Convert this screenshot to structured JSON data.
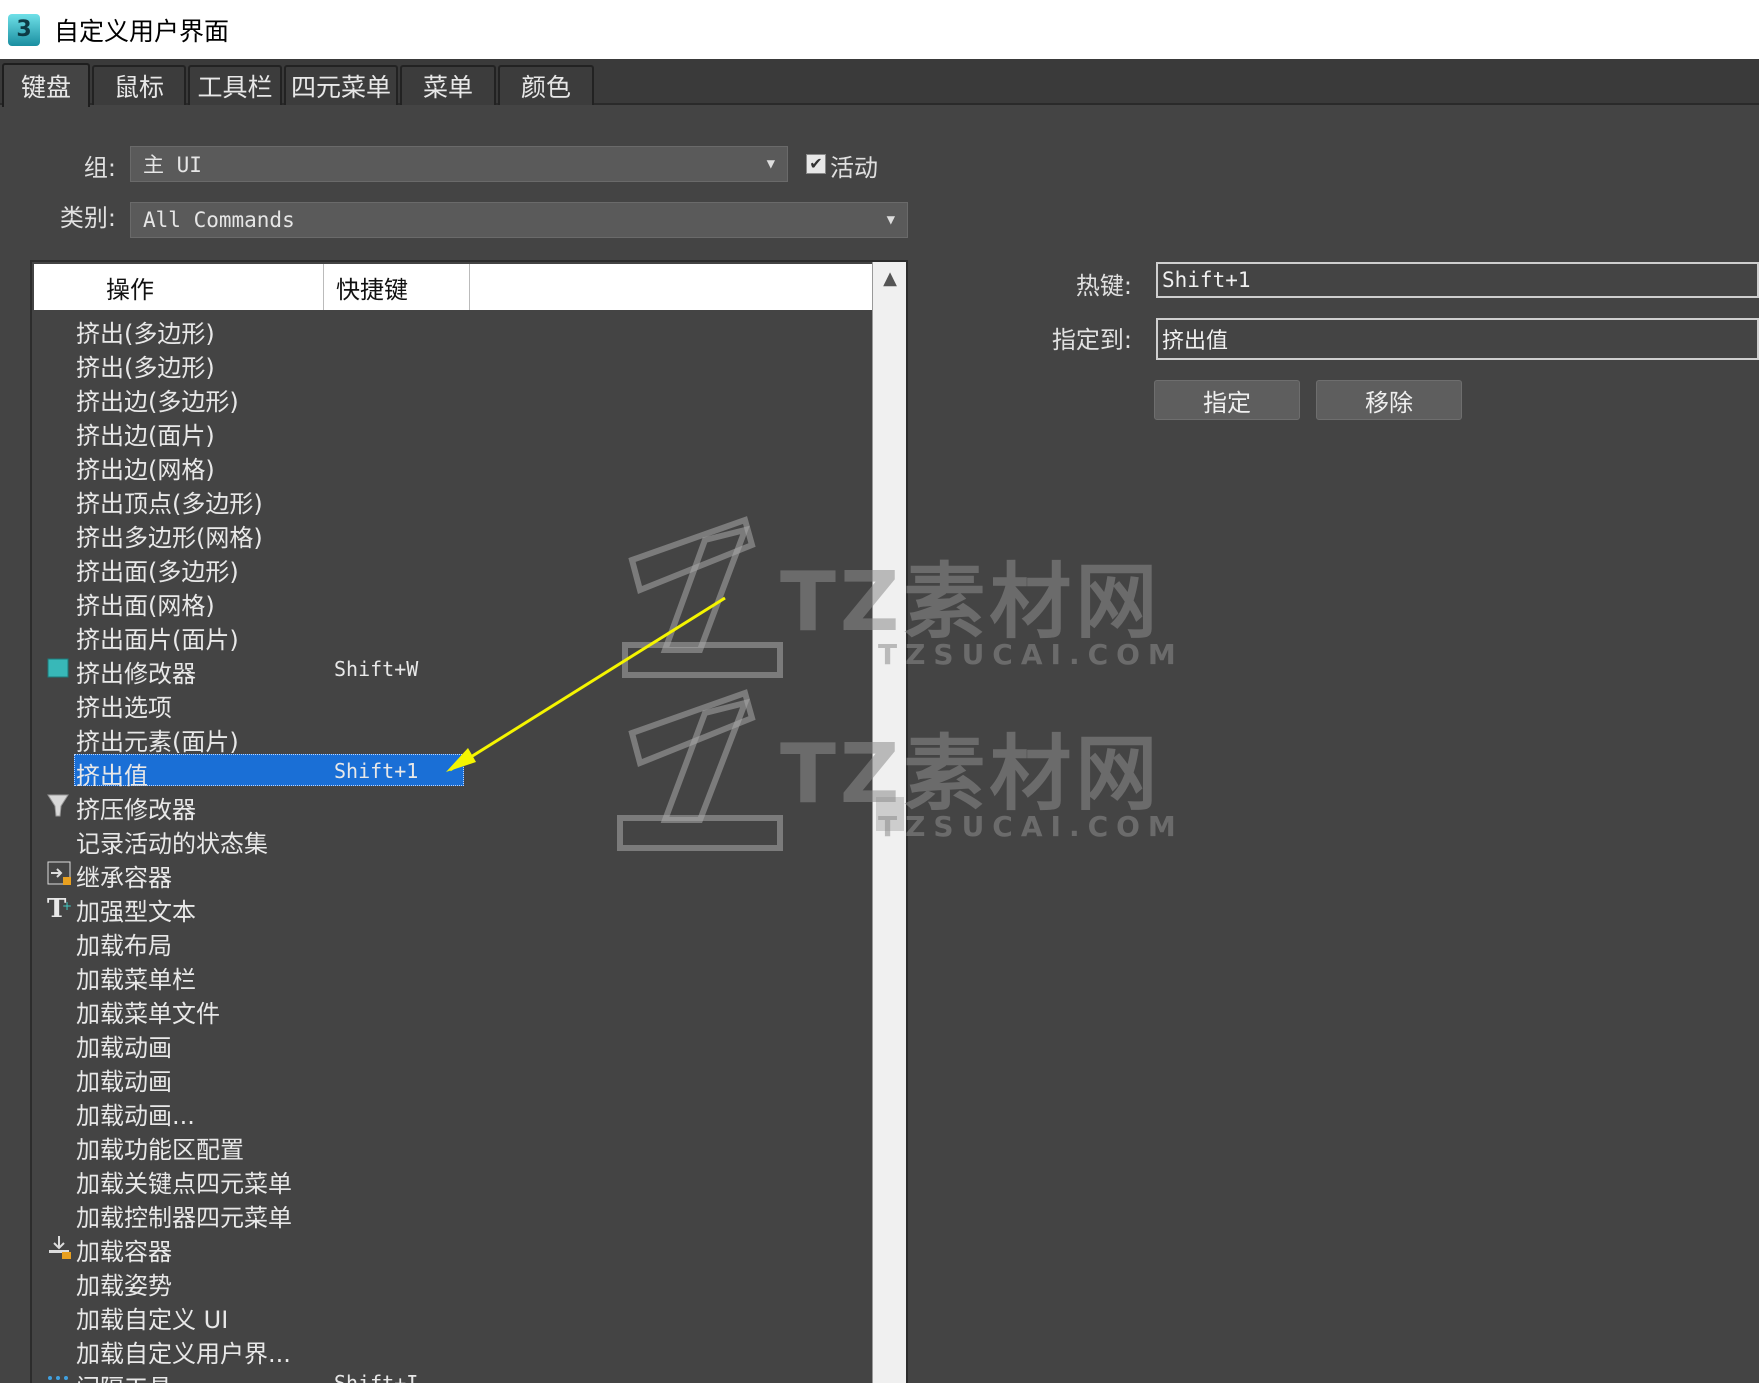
{
  "window": {
    "title": "自定义用户界面",
    "icon_glyph": "3"
  },
  "tabs": [
    {
      "label": "键盘",
      "active": true
    },
    {
      "label": "鼠标"
    },
    {
      "label": "工具栏"
    },
    {
      "label": "四元菜单"
    },
    {
      "label": "菜单"
    },
    {
      "label": "颜色"
    }
  ],
  "group": {
    "label": "组:",
    "value": "主 UI",
    "active_label": "活动",
    "active_checked": true
  },
  "category": {
    "label": "类别:",
    "value": "All Commands"
  },
  "list": {
    "headers": {
      "action": "操作",
      "shortcut": "快捷键"
    },
    "rows": [
      {
        "op": "挤出(多边形)",
        "sc": ""
      },
      {
        "op": "挤出(多边形)",
        "sc": ""
      },
      {
        "op": "挤出边(多边形)",
        "sc": ""
      },
      {
        "op": "挤出边(面片)",
        "sc": ""
      },
      {
        "op": "挤出边(网格)",
        "sc": ""
      },
      {
        "op": "挤出顶点(多边形)",
        "sc": ""
      },
      {
        "op": "挤出多边形(网格)",
        "sc": ""
      },
      {
        "op": "挤出面(多边形)",
        "sc": ""
      },
      {
        "op": "挤出面(网格)",
        "sc": ""
      },
      {
        "op": "挤出面片(面片)",
        "sc": ""
      },
      {
        "op": "挤出修改器",
        "sc": "Shift+W",
        "icon": "extrude-modifier-icon"
      },
      {
        "op": "挤出选项",
        "sc": ""
      },
      {
        "op": "挤出元素(面片)",
        "sc": ""
      },
      {
        "op": "挤出值",
        "sc": "Shift+1",
        "selected": true
      },
      {
        "op": "挤压修改器",
        "sc": "",
        "icon": "squeeze-modifier-icon"
      },
      {
        "op": "记录活动的状态集",
        "sc": ""
      },
      {
        "op": "继承容器",
        "sc": "",
        "icon": "inherit-container-icon"
      },
      {
        "op": "加强型文本",
        "sc": "",
        "icon": "text-plus-icon"
      },
      {
        "op": "加载布局",
        "sc": ""
      },
      {
        "op": "加载菜单栏",
        "sc": ""
      },
      {
        "op": "加载菜单文件",
        "sc": ""
      },
      {
        "op": "加载动画",
        "sc": ""
      },
      {
        "op": "加载动画",
        "sc": ""
      },
      {
        "op": "加载动画...",
        "sc": ""
      },
      {
        "op": "加载功能区配置",
        "sc": ""
      },
      {
        "op": "加载关键点四元菜单",
        "sc": ""
      },
      {
        "op": "加载控制器四元菜单",
        "sc": ""
      },
      {
        "op": "加载容器",
        "sc": "",
        "icon": "load-container-icon"
      },
      {
        "op": "加载姿势",
        "sc": ""
      },
      {
        "op": "加载自定义 UI",
        "sc": ""
      },
      {
        "op": "加载自定义用户界...",
        "sc": ""
      },
      {
        "op": "间隔工具",
        "sc": "Shift+I",
        "icon": "spacing-tool-icon"
      }
    ]
  },
  "hotkey": {
    "label": "热键:",
    "value": "Shift+1"
  },
  "assigned_to": {
    "label": "指定到:",
    "value": "挤出值"
  },
  "buttons": {
    "assign": "指定",
    "remove": "移除"
  },
  "watermark": {
    "cn": "TZ素材网",
    "en": "TZSUCAI.COM"
  },
  "colors": {
    "background": "#444444",
    "selection": "#1a6fd6",
    "arrow": "#f5f500"
  }
}
